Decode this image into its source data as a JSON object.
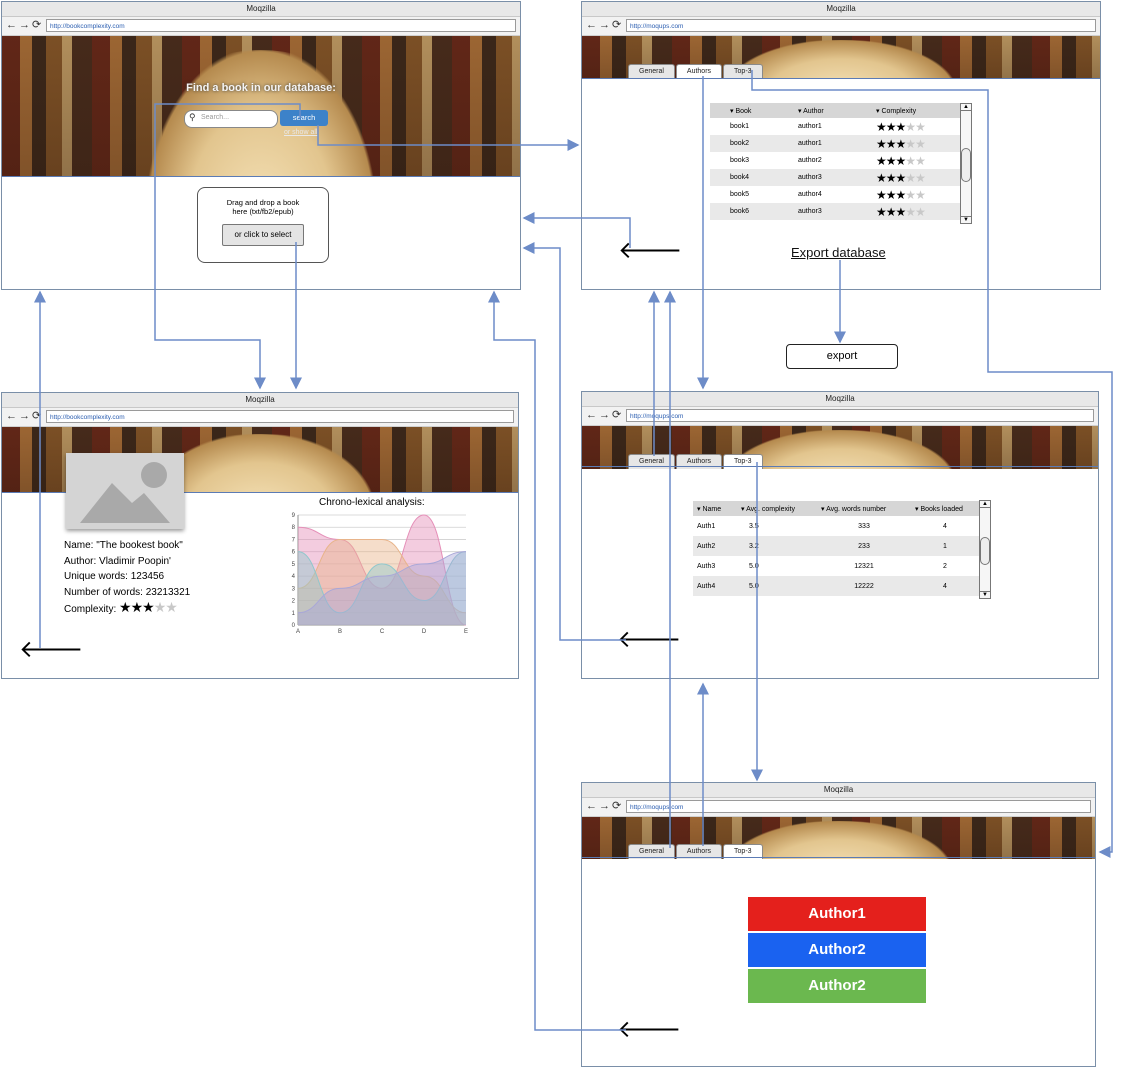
{
  "browser": {
    "title": "Moqzilla",
    "nav_icons": "←→⟳"
  },
  "home": {
    "url": "http://bookcomplexity.com",
    "heading": "Find a book in our database:",
    "search_placeholder": "Search...",
    "search_button": "search",
    "show_all": "or show all",
    "drop_text_1": "Drag and drop a book",
    "drop_text_2": "here (txt/fb2/epub)",
    "select_button": "or click to select"
  },
  "books": {
    "url": "http://moqups.com",
    "tabs": [
      "General",
      "Authors",
      "Top-3"
    ],
    "columns": [
      "▾ Book",
      "▾ Author",
      "▾ Complexity"
    ],
    "rows": [
      {
        "book": "book1",
        "author": "author1",
        "stars": 3
      },
      {
        "book": "book2",
        "author": "author1",
        "stars": 3
      },
      {
        "book": "book3",
        "author": "author2",
        "stars": 3
      },
      {
        "book": "book4",
        "author": "author3",
        "stars": 3
      },
      {
        "book": "book5",
        "author": "author4",
        "stars": 3
      },
      {
        "book": "book6",
        "author": "author3",
        "stars": 3
      }
    ],
    "export_link": "Export database",
    "export_button": "export"
  },
  "detail": {
    "url": "http://bookcomplexity.com",
    "name": "Name: \"The bookest book\"",
    "author": "Author: Vladimir Poopin'",
    "unique": "Unique words: 123456",
    "words": "Number of words: 23213321",
    "complexity_label": "Complexity:",
    "complexity_stars": 3
  },
  "chart_data": {
    "type": "area",
    "title": "Chrono-lexical analysis:",
    "x": [
      "A",
      "B",
      "C",
      "D",
      "E"
    ],
    "ylim": [
      0,
      9
    ],
    "yticks": [
      "0",
      "1",
      "2",
      "3",
      "4",
      "5",
      "6",
      "7",
      "8",
      "9"
    ],
    "series": [
      {
        "values": [
          8,
          7,
          3,
          9,
          0
        ],
        "color": "#e58fb8"
      },
      {
        "values": [
          3,
          7,
          7,
          4,
          1
        ],
        "color": "#e8b48a"
      },
      {
        "values": [
          6,
          1,
          5,
          2,
          6
        ],
        "color": "#8fc7cc"
      },
      {
        "values": [
          1,
          3,
          4,
          5,
          6
        ],
        "color": "#a9a7d8"
      }
    ],
    "grid": true
  },
  "authors": {
    "url": "http://moqups.com",
    "tabs": [
      "General",
      "Authors",
      "Top-3"
    ],
    "columns": [
      "▾ Name",
      "▾ Avg. complexity",
      "▾ Avg. words number",
      "▾ Books loaded"
    ],
    "rows": [
      {
        "name": "Auth1",
        "avg": "3.5",
        "words": "333",
        "books": "4"
      },
      {
        "name": "Auth2",
        "avg": "3.2",
        "words": "233",
        "books": "1"
      },
      {
        "name": "Auth3",
        "avg": "5.0",
        "words": "12321",
        "books": "2"
      },
      {
        "name": "Auth4",
        "avg": "5.0",
        "words": "12222",
        "books": "4"
      }
    ]
  },
  "top3": {
    "url": "http://moqups.com",
    "tabs": [
      "General",
      "Authors",
      "Top-3"
    ],
    "items": [
      {
        "label": "Author1",
        "color": "#e4201c"
      },
      {
        "label": "Author2",
        "color": "#1a62f0"
      },
      {
        "label": "Author2",
        "color": "#6bb84f"
      }
    ]
  },
  "back_arrow": "🡐"
}
